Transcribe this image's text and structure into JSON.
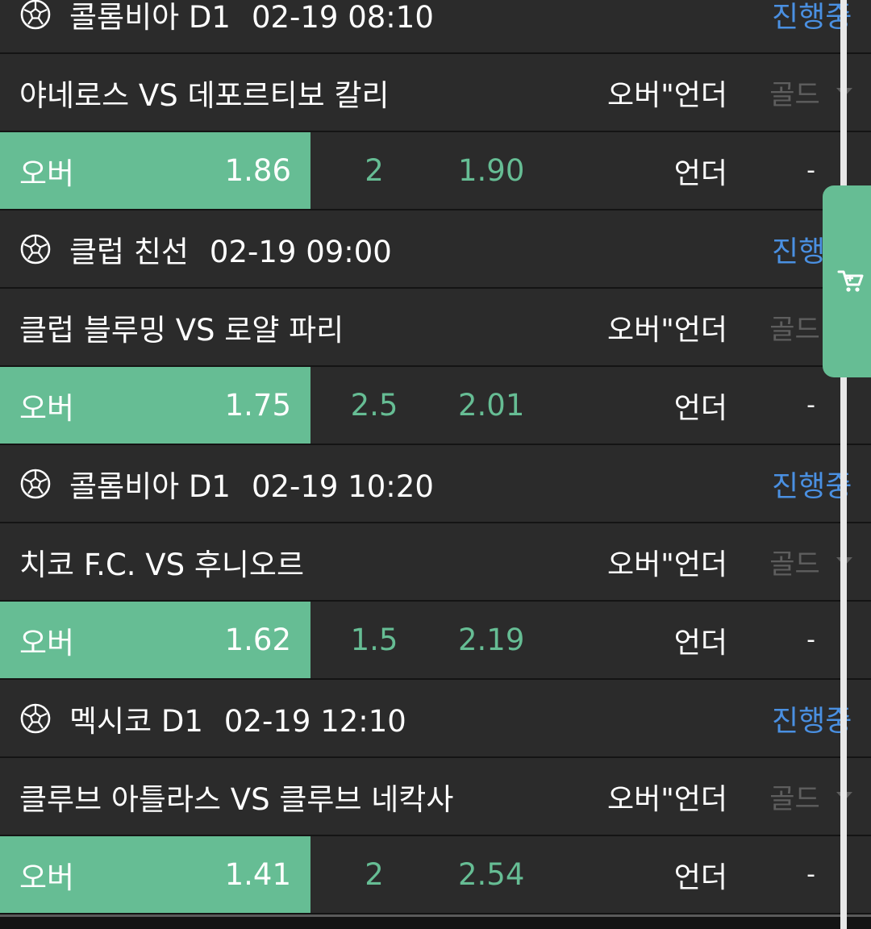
{
  "colors": {
    "accent_green": "#66bd94",
    "status_blue": "#4a90e2",
    "row_bg": "#2b2b2b",
    "separator": "#141414"
  },
  "games": [
    {
      "league": "콜롬비아 D1",
      "datetime": "02-19 08:10",
      "status": "진행중",
      "match": "야네로스 VS 데포르티보 칼리",
      "market": "오버\"언더",
      "gold": "골드",
      "over_label": "오버",
      "over_odds": "1.86",
      "line": "2",
      "under_odds": "1.90",
      "under_label": "언더",
      "dash": "-"
    },
    {
      "league": "클럽 친선",
      "datetime": "02-19 09:00",
      "status": "진행중",
      "match": "클럽 블루밍 VS 로얄 파리",
      "market": "오버\"언더",
      "gold": "골드",
      "over_label": "오버",
      "over_odds": "1.75",
      "line": "2.5",
      "under_odds": "2.01",
      "under_label": "언더",
      "dash": "-"
    },
    {
      "league": "콜롬비아 D1",
      "datetime": "02-19 10:20",
      "status": "진행중",
      "match": "치코 F.C. VS 후니오르",
      "market": "오버\"언더",
      "gold": "골드",
      "over_label": "오버",
      "over_odds": "1.62",
      "line": "1.5",
      "under_odds": "2.19",
      "under_label": "언더",
      "dash": "-"
    },
    {
      "league": "멕시코 D1",
      "datetime": "02-19 12:10",
      "status": "진행중",
      "match": "클루브 아틀라스 VS 클루브 네칵사",
      "market": "오버\"언더",
      "gold": "골드",
      "over_label": "오버",
      "over_odds": "1.41",
      "line": "2",
      "under_odds": "2.54",
      "under_label": "언더",
      "dash": "-"
    }
  ],
  "cart": {
    "icon": "cart-icon"
  }
}
